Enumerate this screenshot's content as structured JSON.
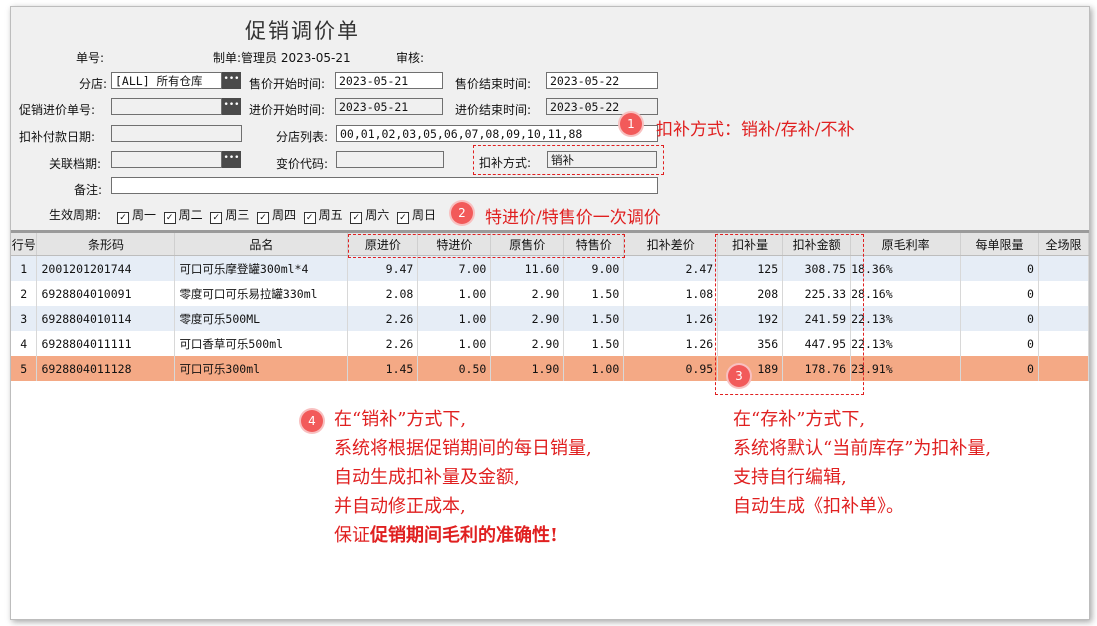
{
  "form": {
    "title": "促销调价单",
    "order_no_label": "单号:",
    "creator_text": "制单:管理员  2023-05-21",
    "audit_label": "审核:",
    "branch_label": "分店:",
    "branch_value": "[ALL] 所有仓库",
    "sale_start_label": "售价开始时间:",
    "sale_start_value": "2023-05-21",
    "sale_end_label": "售价结束时间:",
    "sale_end_value": "2023-05-22",
    "promo_purchase_label": "促销进价单号:",
    "promo_purchase_value": "",
    "purchase_start_label": "进价开始时间:",
    "purchase_start_value": "2023-05-21",
    "purchase_end_label": "进价结束时间:",
    "purchase_end_value": "2023-05-22",
    "deduct_date_label": "扣补付款日期:",
    "deduct_date_value": "",
    "branch_list_label": "分店列表:",
    "branch_list_value": "00,01,02,03,05,06,07,08,09,10,11,88",
    "related_label": "关联档期:",
    "related_value": "",
    "change_code_label": "变价代码:",
    "change_code_value": "",
    "deduct_method_label": "扣补方式:",
    "deduct_method_value": "销补",
    "remark_label": "备注:",
    "remark_value": "",
    "cycle_label": "生效周期:",
    "days": [
      "周一",
      "周二",
      "周三",
      "周四",
      "周五",
      "周六",
      "周日"
    ]
  },
  "callouts": {
    "c1_num": "1",
    "c1_text": "扣补方式：销补/存补/不补",
    "c2_num": "2",
    "c2_text": "特进价/特售价一次调价",
    "c3_num": "3",
    "c4_num": "4",
    "note_left": [
      "在“销补”方式下,",
      "系统将根据促销期间的每日销量,",
      "自动生成扣补量及金额,",
      "并自动修正成本,"
    ],
    "note_left_last_prefix": "保证",
    "note_left_last_bold": "促销期间毛利的准确性",
    "note_left_last_suffix": "!",
    "note_right": [
      "在“存补”方式下,",
      "系统将默认“当前库存”为扣补量,",
      "支持自行编辑,",
      "自动生成《扣补单》。"
    ]
  },
  "table": {
    "headers": [
      "行号",
      "条形码",
      "品名",
      "原进价",
      "特进价",
      "原售价",
      "特售价",
      "扣补差价",
      "扣补量",
      "扣补金额",
      "原毛利率",
      "每单限量",
      "全场限"
    ],
    "rows": [
      [
        "1",
        "2001201201744",
        "可口可乐摩登罐300ml*4",
        "9.47",
        "7.00",
        "11.60",
        "9.00",
        "2.47",
        "125",
        "308.75",
        "18.36%",
        "0",
        ""
      ],
      [
        "2",
        "6928804010091",
        "零度可口可乐易拉罐330ml",
        "2.08",
        "1.00",
        "2.90",
        "1.50",
        "1.08",
        "208",
        "225.33",
        "28.16%",
        "0",
        ""
      ],
      [
        "3",
        "6928804010114",
        "零度可乐500ML",
        "2.26",
        "1.00",
        "2.90",
        "1.50",
        "1.26",
        "192",
        "241.59",
        "22.13%",
        "0",
        ""
      ],
      [
        "4",
        "6928804011111",
        "可口香草可乐500ml",
        "2.26",
        "1.00",
        "2.90",
        "1.50",
        "1.26",
        "356",
        "447.95",
        "22.13%",
        "0",
        ""
      ],
      [
        "5",
        "6928804011128",
        "可口可乐300ml",
        "1.45",
        "0.50",
        "1.90",
        "1.00",
        "0.95",
        "189",
        "178.76",
        "23.91%",
        "0",
        ""
      ]
    ]
  },
  "colors": {
    "accent_red": "#e02020",
    "selected_row": "#f4a985",
    "alt_row": "#e6edf6"
  }
}
